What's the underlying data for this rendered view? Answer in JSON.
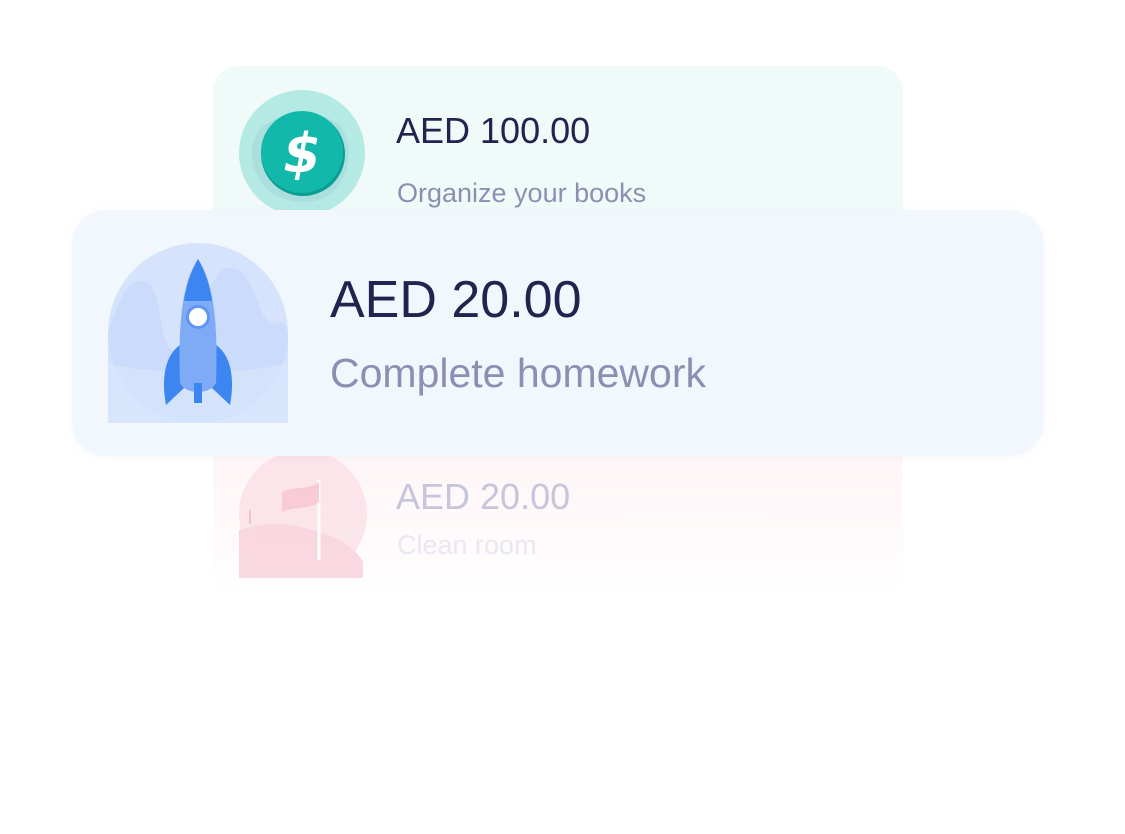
{
  "currency_cards": [
    {
      "id": "books",
      "amount": "AED 100.00",
      "task": "Organize your books",
      "icon": "dollar-coin-icon",
      "accent": "#0fb8aa"
    },
    {
      "id": "homework",
      "amount": "AED 20.00",
      "task": "Complete homework",
      "icon": "rocket-icon",
      "accent": "#3d86f2"
    },
    {
      "id": "room",
      "amount": "AED 20.00",
      "task": "Clean room",
      "icon": "flag-icon",
      "accent": "#f4b7c6"
    }
  ],
  "colors": {
    "amount_text": "#24224f",
    "task_text": "#8d8fb2",
    "front_card_bg": "#f2f7fd",
    "top_card_bg": "#f0faf8",
    "bottom_card_bg": "#fdf3f5"
  }
}
